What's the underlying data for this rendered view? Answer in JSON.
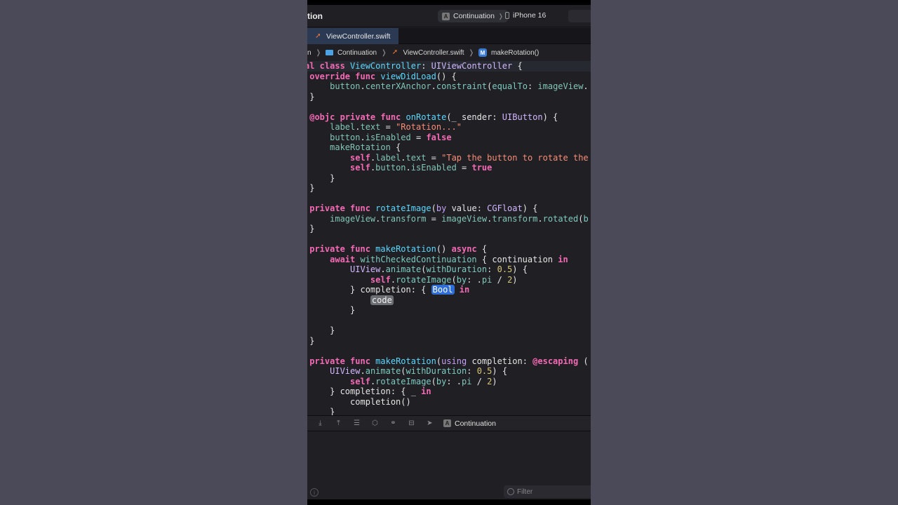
{
  "window": {
    "title_partial": "tion",
    "scheme": "Continuation",
    "destination": "iPhone 16"
  },
  "tab": {
    "label": "ViewController.swift"
  },
  "breadcrumb": {
    "first_partial": "n",
    "folder": "Continuation",
    "file": "ViewController.swift",
    "method_badge": "M",
    "method": "makeRotation()"
  },
  "placeholders": {
    "type": "Bool",
    "code": "code"
  },
  "debug": {
    "target": "Continuation"
  },
  "console": {
    "filter_placeholder": "Filter"
  },
  "colors": {
    "keyword": "#f56ab5",
    "type": "#d3b7ff",
    "function": "#7ecbc1",
    "string": "#f88e78",
    "number": "#d8c877",
    "tab_active": "#2b3a52"
  },
  "icons": [
    "swift-file-icon",
    "folder-icon",
    "method-icon",
    "app-icon",
    "phone-icon",
    "info-icon",
    "filter-icon"
  ]
}
